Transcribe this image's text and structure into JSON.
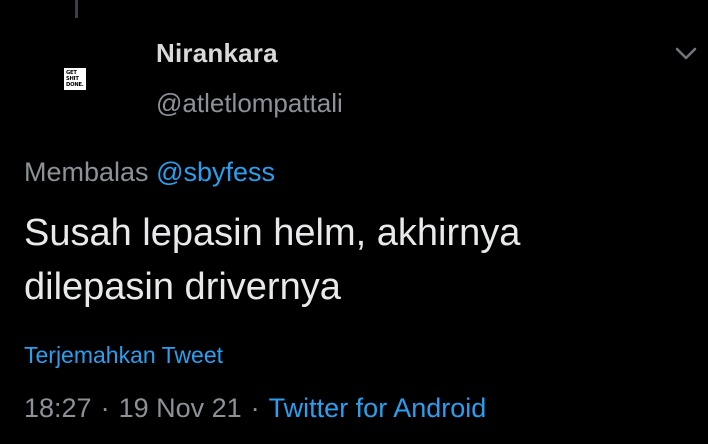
{
  "tweet": {
    "display_name": "Nirankara",
    "handle": "@atletlompattali",
    "avatar_text": [
      "GET",
      "SHIT",
      "DONE."
    ],
    "reply_prefix": "Membalas",
    "reply_to": "@sbyfess",
    "text_lines": [
      "Susah lepasin helm, akhirnya",
      "dilepasin drivernya"
    ],
    "translate_label": "Terjemahkan Tweet",
    "time": "18:27",
    "date": "19 Nov 21",
    "separator": "·",
    "source": "Twitter for Android"
  },
  "icons": {
    "caret": "chevron-down-icon"
  },
  "colors": {
    "background": "#000000",
    "link": "#2a9ff0",
    "muted": "#8b9298",
    "text": "#e7e9ea"
  }
}
